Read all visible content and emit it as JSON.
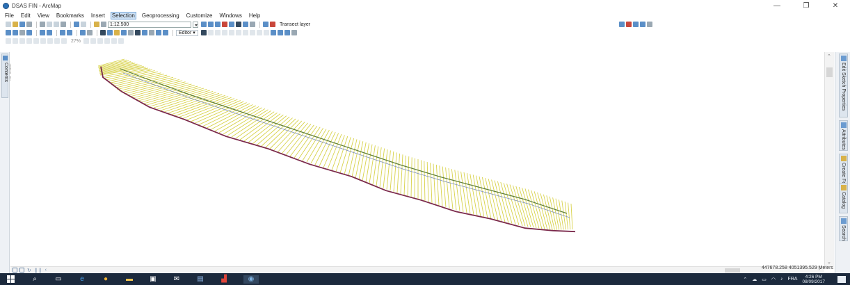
{
  "window": {
    "title": "DSAS FIN - ArcMap",
    "controls": [
      "—",
      "❐",
      "✕"
    ]
  },
  "menu": {
    "items": [
      "File",
      "Edit",
      "View",
      "Bookmarks",
      "Insert",
      "Selection",
      "Geoprocessing",
      "Customize",
      "Windows",
      "Help"
    ],
    "active": "Selection"
  },
  "toolbar": {
    "scale": "1:12.500",
    "transect_layer_label": "Transect layer",
    "editor_label": "Editor ▾",
    "zoom_percent": "27%"
  },
  "left_dock": {
    "toc_label": "Table Of Contents"
  },
  "right_dock": {
    "tabs": [
      "Edit Sketch Properties",
      "Attributes",
      "Create Features",
      "Catalog",
      "Search"
    ]
  },
  "status": {
    "coordinates": "447678.258  4051395.529 Meters"
  },
  "taskbar": {
    "language": "FRA",
    "time": "4:26 PM",
    "date": "08/09/2017"
  },
  "colors": {
    "shoreline": "#7b2a4c",
    "transect": "#d8d24a",
    "baseline": "#5f7f3a",
    "inner_line": "#7c8fb8",
    "taskbar": "#1c2a3d"
  }
}
